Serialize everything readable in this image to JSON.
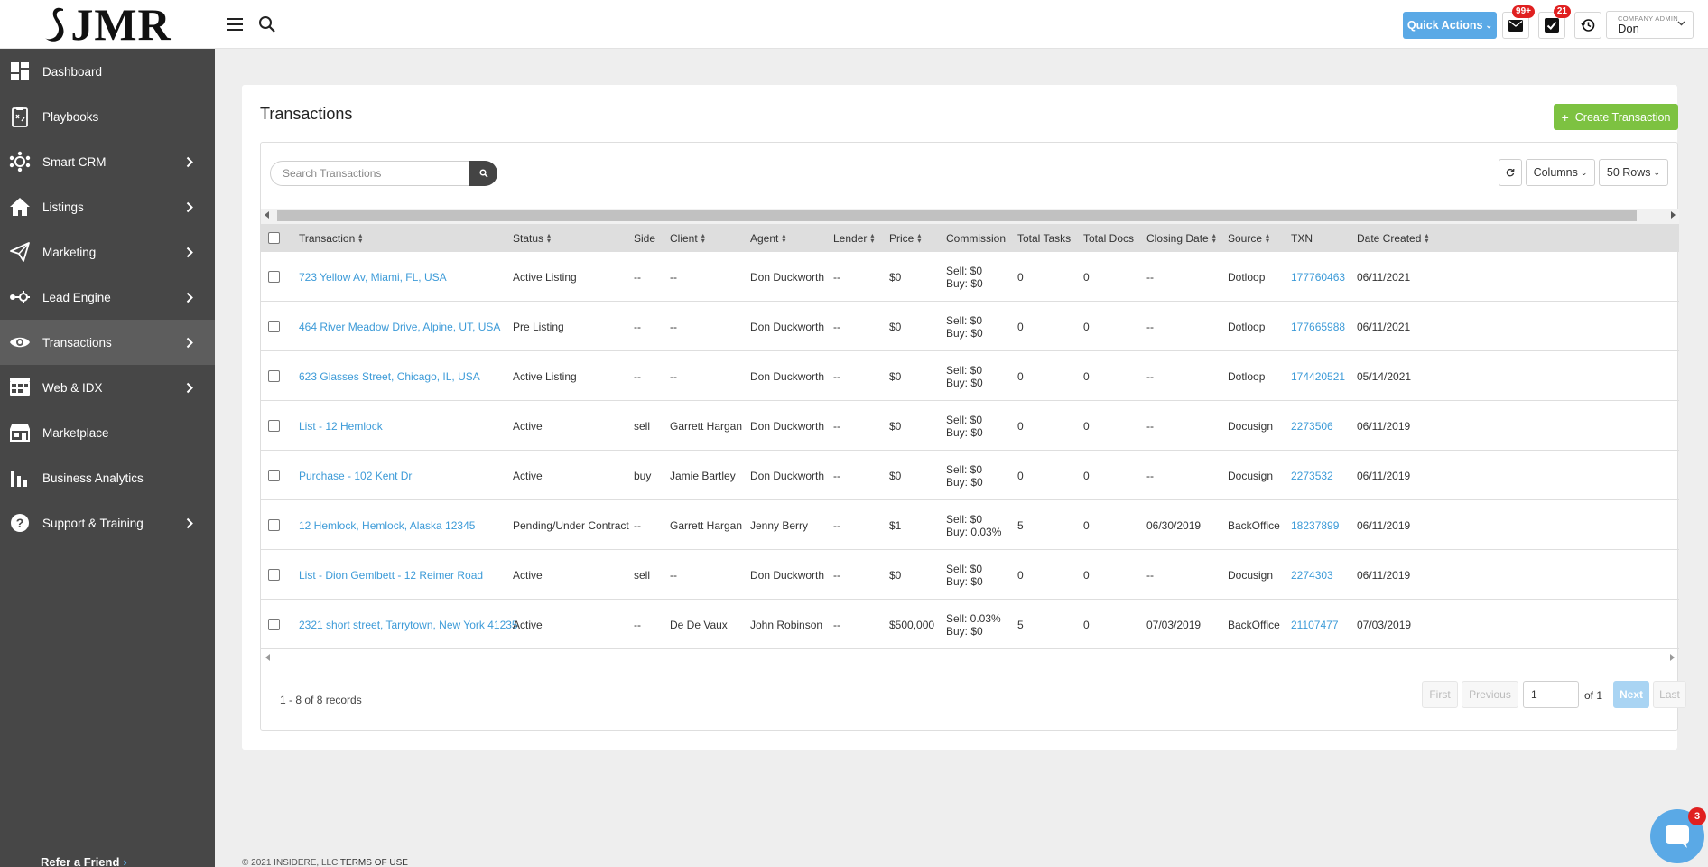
{
  "brand": {
    "logo_text": "JMR"
  },
  "sidebar": {
    "items": [
      {
        "label": "Dashboard",
        "icon": "dashboard-icon",
        "has_submenu": false,
        "active": false
      },
      {
        "label": "Playbooks",
        "icon": "playbooks-icon",
        "has_submenu": false,
        "active": false
      },
      {
        "label": "Smart CRM",
        "icon": "crm-icon",
        "has_submenu": true,
        "active": false
      },
      {
        "label": "Listings",
        "icon": "house-icon",
        "has_submenu": true,
        "active": false
      },
      {
        "label": "Marketing",
        "icon": "paper-plane-icon",
        "has_submenu": true,
        "active": false
      },
      {
        "label": "Lead Engine",
        "icon": "lead-engine-icon",
        "has_submenu": true,
        "active": false
      },
      {
        "label": "Transactions",
        "icon": "eye-icon",
        "has_submenu": true,
        "active": true
      },
      {
        "label": "Web & IDX",
        "icon": "web-idx-icon",
        "has_submenu": true,
        "active": false
      },
      {
        "label": "Marketplace",
        "icon": "marketplace-icon",
        "has_submenu": false,
        "active": false
      },
      {
        "label": "Business Analytics",
        "icon": "bar-chart-icon",
        "has_submenu": false,
        "active": false
      },
      {
        "label": "Support & Training",
        "icon": "help-icon",
        "has_submenu": true,
        "active": false
      }
    ],
    "refer_label": "Refer a Friend"
  },
  "header": {
    "quick_actions_label": "Quick Actions",
    "mail_badge": "99+",
    "tasks_badge": "21",
    "user_role": "COMPANY ADMIN",
    "user_name": "Don"
  },
  "page": {
    "title": "Transactions",
    "create_label": "Create Transaction",
    "search_placeholder": "Search Transactions",
    "columns_label": "Columns",
    "rows_label": "50 Rows"
  },
  "table": {
    "headers": [
      "Transaction",
      "Status",
      "Side",
      "Client",
      "Agent",
      "Lender",
      "Price",
      "Commission",
      "Total Tasks",
      "Total Docs",
      "Closing Date",
      "Source",
      "TXN",
      "Date Created"
    ],
    "rows": [
      {
        "transaction": "723 Yellow Av, Miami, FL, USA",
        "status": "Active Listing",
        "side": "--",
        "client": "--",
        "agent": "Don Duckworth",
        "lender": "--",
        "price": "$0",
        "sell": "Sell: $0",
        "buy": "Buy: $0",
        "tasks": "0",
        "docs": "0",
        "closing": "--",
        "source": "Dotloop",
        "txn": "177760463",
        "created": "06/11/2021"
      },
      {
        "transaction": "464 River Meadow Drive, Alpine, UT, USA",
        "status": "Pre Listing",
        "side": "--",
        "client": "--",
        "agent": "Don Duckworth",
        "lender": "--",
        "price": "$0",
        "sell": "Sell: $0",
        "buy": "Buy: $0",
        "tasks": "0",
        "docs": "0",
        "closing": "--",
        "source": "Dotloop",
        "txn": "177665988",
        "created": "06/11/2021"
      },
      {
        "transaction": "623 Glasses Street, Chicago, IL, USA",
        "status": "Active Listing",
        "side": "--",
        "client": "--",
        "agent": "Don Duckworth",
        "lender": "--",
        "price": "$0",
        "sell": "Sell: $0",
        "buy": "Buy: $0",
        "tasks": "0",
        "docs": "0",
        "closing": "--",
        "source": "Dotloop",
        "txn": "174420521",
        "created": "05/14/2021"
      },
      {
        "transaction": "List - 12 Hemlock",
        "status": "Active",
        "side": "sell",
        "client": "Garrett Hargan",
        "agent": "Don Duckworth",
        "lender": "--",
        "price": "$0",
        "sell": "Sell: $0",
        "buy": "Buy: $0",
        "tasks": "0",
        "docs": "0",
        "closing": "--",
        "source": "Docusign",
        "txn": "2273506",
        "created": "06/11/2019"
      },
      {
        "transaction": "Purchase - 102 Kent Dr",
        "status": "Active",
        "side": "buy",
        "client": "Jamie Bartley",
        "agent": "Don Duckworth",
        "lender": "--",
        "price": "$0",
        "sell": "Sell: $0",
        "buy": "Buy: $0",
        "tasks": "0",
        "docs": "0",
        "closing": "--",
        "source": "Docusign",
        "txn": "2273532",
        "created": "06/11/2019"
      },
      {
        "transaction": "12 Hemlock, Hemlock, Alaska 12345",
        "status": "Pending/Under Contract",
        "side": "--",
        "client": "Garrett Hargan",
        "agent": "Jenny Berry",
        "lender": "--",
        "price": "$1",
        "sell": "Sell: $0",
        "buy": "Buy: 0.03%",
        "tasks": "5",
        "docs": "0",
        "closing": "06/30/2019",
        "source": "BackOffice",
        "txn": "18237899",
        "created": "06/11/2019"
      },
      {
        "transaction": "List - Dion Gemlbett - 12 Reimer Road",
        "status": "Active",
        "side": "sell",
        "client": "--",
        "agent": "Don Duckworth",
        "lender": "--",
        "price": "$0",
        "sell": "Sell: $0",
        "buy": "Buy: $0",
        "tasks": "0",
        "docs": "0",
        "closing": "--",
        "source": "Docusign",
        "txn": "2274303",
        "created": "06/11/2019"
      },
      {
        "transaction": "2321 short street, Tarrytown, New York 41235",
        "status": "Active",
        "side": "--",
        "client": "De De Vaux",
        "agent": "John Robinson",
        "lender": "--",
        "price": "$500,000",
        "sell": "Sell: 0.03%",
        "buy": "Buy: $0",
        "tasks": "5",
        "docs": "0",
        "closing": "07/03/2019",
        "source": "BackOffice",
        "txn": "21107477",
        "created": "07/03/2019"
      }
    ]
  },
  "pagination": {
    "records": "1 - 8 of 8 records",
    "first": "First",
    "previous": "Previous",
    "page": "1",
    "of": "of 1",
    "next": "Next",
    "last": "Last"
  },
  "footer": {
    "copyright": "© 2021 INSIDERE, LLC",
    "terms": "TERMS OF USE"
  },
  "chat": {
    "badge": "3"
  },
  "colors": {
    "sidebar_bg": "#474747",
    "accent_blue": "#5aa9e6",
    "create_green": "#7dc241",
    "link": "#3d9bd8",
    "badge_red": "#e02020"
  }
}
